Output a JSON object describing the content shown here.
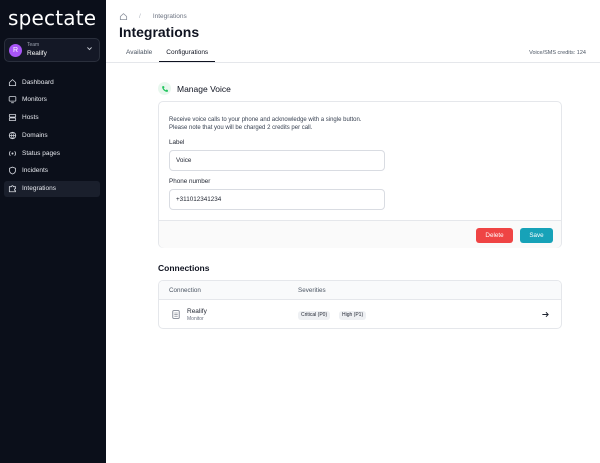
{
  "app": {
    "logo": "spectate"
  },
  "team": {
    "avatar_letter": "R",
    "label": "Team",
    "name": "Realify"
  },
  "sidebar": {
    "items": [
      {
        "label": "Dashboard",
        "icon": "home-icon",
        "active": false
      },
      {
        "label": "Monitors",
        "icon": "monitor-icon",
        "active": false
      },
      {
        "label": "Hosts",
        "icon": "server-icon",
        "active": false
      },
      {
        "label": "Domains",
        "icon": "globe-icon",
        "active": false
      },
      {
        "label": "Status pages",
        "icon": "signal-icon",
        "active": false
      },
      {
        "label": "Incidents",
        "icon": "shield-icon",
        "active": false
      },
      {
        "label": "Integrations",
        "icon": "puzzle-icon",
        "active": true
      }
    ]
  },
  "breadcrumb": {
    "home_icon": "home-icon",
    "current": "Integrations"
  },
  "page": {
    "title": "Integrations"
  },
  "tabs": [
    {
      "label": "Available",
      "active": false
    },
    {
      "label": "Configurations",
      "active": true
    }
  ],
  "credits": "Voice/SMS credits: 124",
  "manage_voice": {
    "icon": "phone-icon",
    "title": "Manage Voice",
    "description_line1": "Receive voice calls to your phone and acknowledge with a single button.",
    "description_line2": "Please note that you will be charged 2 credits per call.",
    "label_field": {
      "label": "Label",
      "value": "Voice"
    },
    "phone_field": {
      "label": "Phone number",
      "value": "+311012341234"
    },
    "delete_label": "Delete",
    "save_label": "Save"
  },
  "connections": {
    "title": "Connections",
    "columns": [
      "Connection",
      "Severities"
    ],
    "rows": [
      {
        "icon": "document-icon",
        "name": "Realify",
        "type": "Monitor",
        "severities": [
          "Critical (P0)",
          "High (P1)"
        ],
        "action_icon": "arrow-right-icon"
      }
    ]
  },
  "colors": {
    "sidebar_bg": "#0b0f1a",
    "accent_save": "#17a2b8",
    "danger": "#ef4444",
    "team_avatar": "#a855f7",
    "voice_icon": "#22c55e"
  }
}
